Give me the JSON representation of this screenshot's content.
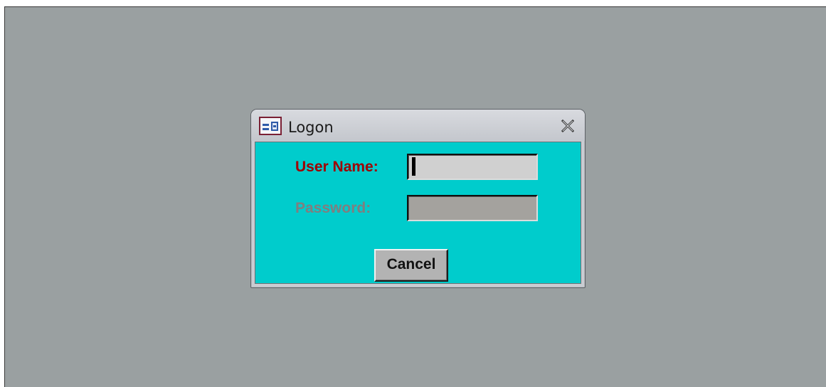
{
  "window": {
    "title": "Logon",
    "icon": "form-icon"
  },
  "form": {
    "user_label": "User Name:",
    "user_value": "",
    "password_label": "Password:",
    "password_value": "",
    "cancel_label": "Cancel"
  },
  "colors": {
    "desktop_background": "#9aa0a1",
    "form_background": "#00cccc",
    "active_label": "#a00000",
    "inactive_label": "#7f7f7f"
  }
}
